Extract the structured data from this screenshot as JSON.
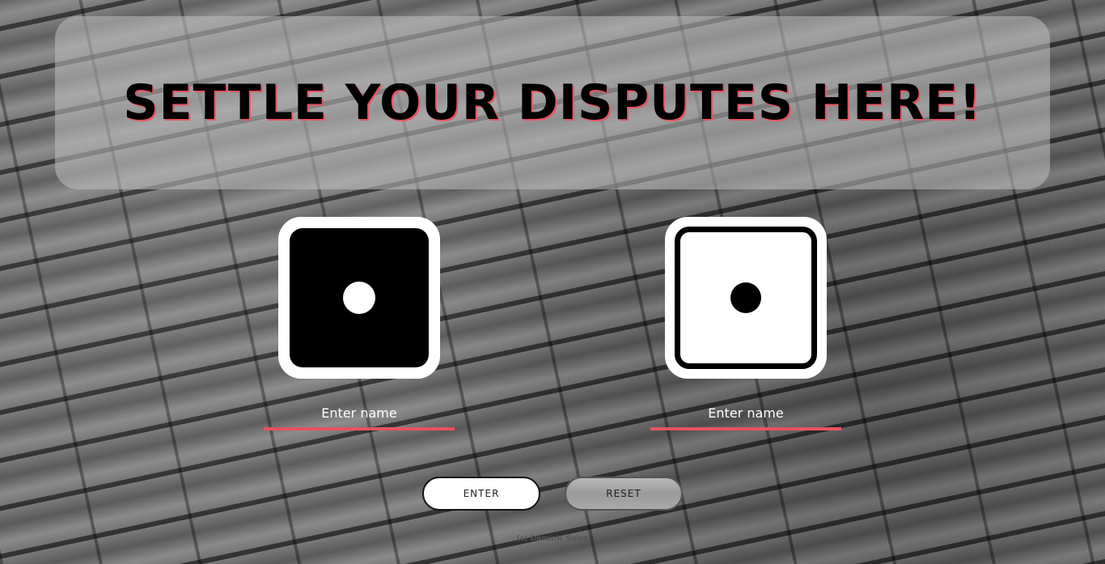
{
  "header": {
    "title": "SETTLE YOUR DISPUTES HERE!"
  },
  "players": [
    {
      "die_style": "black",
      "die_value": 1,
      "name_placeholder": "Enter name"
    },
    {
      "die_style": "white",
      "die_value": 1,
      "name_placeholder": "Enter name"
    }
  ],
  "buttons": {
    "enter_label": "ENTER",
    "reset_label": "RESET"
  },
  "footer": {
    "text": "(c) Dominic Suico"
  },
  "colors": {
    "accent": "#e9525f",
    "banner_bg": "#bebebe"
  },
  "icons": {
    "die_left": "dice-one-icon",
    "die_right": "dice-one-icon"
  }
}
